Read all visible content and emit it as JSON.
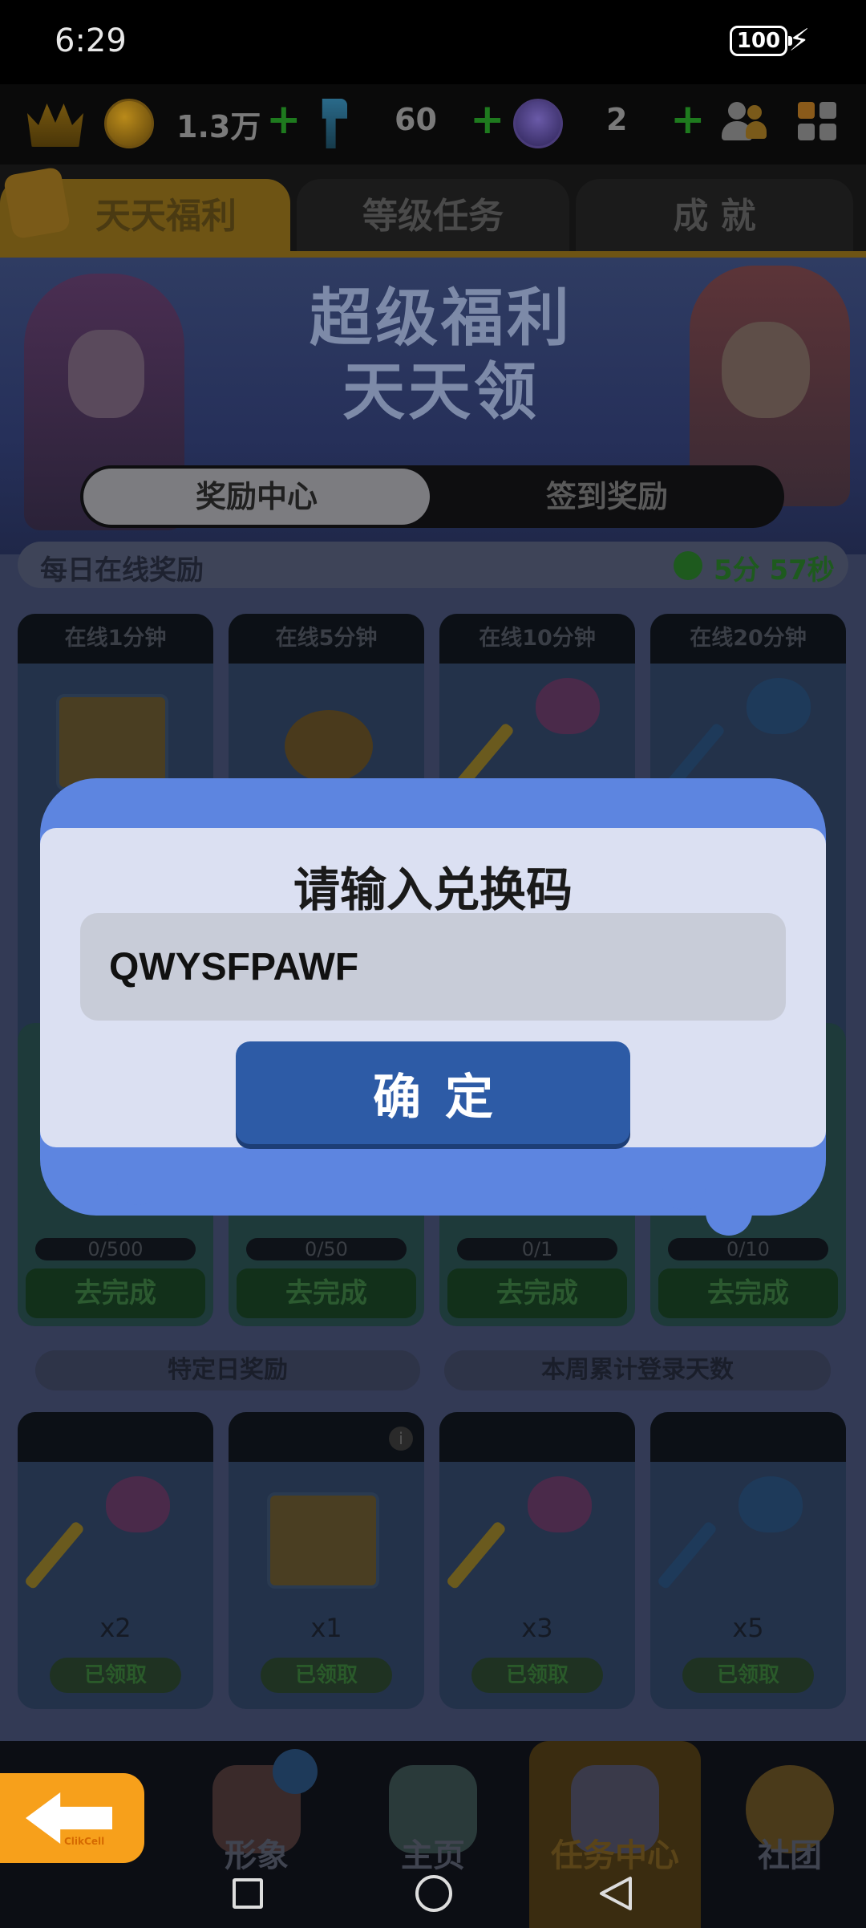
{
  "status_bar": {
    "time": "6:29",
    "battery": "100"
  },
  "currency": {
    "coins": "1.3万",
    "keys": "60",
    "boards": "2"
  },
  "tabs": [
    {
      "label": "天天福利",
      "active": true
    },
    {
      "label": "等级任务",
      "active": false
    },
    {
      "label": "成 就",
      "active": false
    }
  ],
  "banner": {
    "title_line1": "超级福利",
    "title_line2": "天天领"
  },
  "segment": {
    "reward_center": "奖励中心",
    "signin_reward": "签到奖励"
  },
  "online_reward": {
    "label": "每日在线奖励",
    "countdown": "5分 57秒"
  },
  "online_cards": [
    {
      "title": "在线1分钟"
    },
    {
      "title": "在线5分钟"
    },
    {
      "title": "在线10分钟"
    },
    {
      "title": "在线20分钟"
    }
  ],
  "task_cards": [
    {
      "progress": "0/500",
      "button": "去完成"
    },
    {
      "progress": "0/50",
      "button": "去完成"
    },
    {
      "progress": "0/1",
      "button": "去完成"
    },
    {
      "progress": "0/10",
      "button": "去完成"
    }
  ],
  "section_labels": {
    "special_day": "特定日奖励",
    "weekly_login": "本周累计登录天数"
  },
  "reward_cards": [
    {
      "qty": "x2",
      "status": "已领取"
    },
    {
      "qty": "x1",
      "status": "已领取"
    },
    {
      "qty": "x3",
      "status": "已领取"
    },
    {
      "qty": "x5",
      "status": "已领取"
    }
  ],
  "bottom_nav": [
    {
      "label": "形象"
    },
    {
      "label": "主页"
    },
    {
      "label": "任务中心",
      "active": true
    },
    {
      "label": "社团"
    }
  ],
  "back_button": {
    "sub_label": "ClikCell"
  },
  "dialog": {
    "title": "请输入兑换码",
    "code_value": "QWYSFPAWF",
    "confirm_label": "确定"
  },
  "colors": {
    "dialog_frame": "#5d85e0",
    "dialog_panel": "#dbe0f2",
    "confirm_button": "#2d5ba6",
    "back_button": "#f7a01b"
  }
}
